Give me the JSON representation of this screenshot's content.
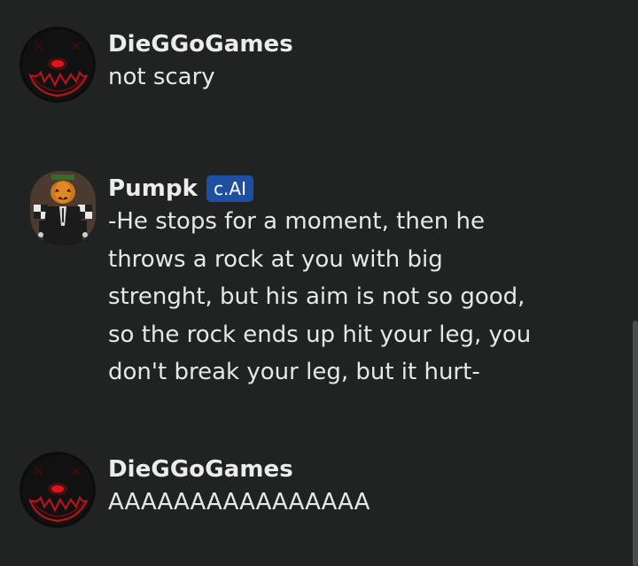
{
  "messages": [
    {
      "author": "DieGGoGames",
      "avatar_icon": "red-eyed-smile-avatar-icon",
      "text": "not scary"
    },
    {
      "author": "Pumpk",
      "badge": "c.AI",
      "avatar_icon": "pumpkin-head-character-avatar-icon",
      "text": "-He stops for a moment, then he throws a rock at you with big strenght, but his aim is not so good, so the rock ends up hit your leg, you don't break your leg, but it hurt-"
    },
    {
      "author": "DieGGoGames",
      "avatar_icon": "red-eyed-smile-avatar-icon",
      "text": "AAAAAAAAAAAAAAAA"
    }
  ],
  "colors": {
    "background": "#212222",
    "text": "#e6e7e8",
    "badge": "#1f4fa0",
    "scrollbar": "#4a4b4c"
  }
}
